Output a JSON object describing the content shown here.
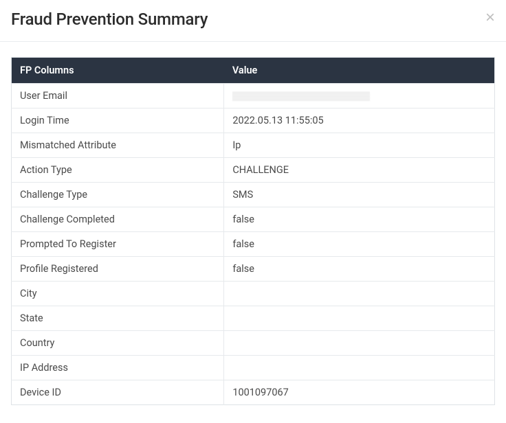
{
  "header": {
    "title": "Fraud Prevention Summary",
    "close_label": "×"
  },
  "table": {
    "columns": {
      "key": "FP Columns",
      "value": "Value"
    },
    "rows": [
      {
        "label": "User Email",
        "value": "",
        "redacted": true
      },
      {
        "label": "Login Time",
        "value": "2022.05.13 11:55:05"
      },
      {
        "label": "Mismatched Attribute",
        "value": "Ip"
      },
      {
        "label": "Action Type",
        "value": "CHALLENGE"
      },
      {
        "label": "Challenge Type",
        "value": "SMS"
      },
      {
        "label": "Challenge Completed",
        "value": "false"
      },
      {
        "label": "Prompted To Register",
        "value": "false"
      },
      {
        "label": "Profile Registered",
        "value": "false"
      },
      {
        "label": "City",
        "value": ""
      },
      {
        "label": "State",
        "value": ""
      },
      {
        "label": "Country",
        "value": ""
      },
      {
        "label": "IP Address",
        "value": ""
      },
      {
        "label": "Device ID",
        "value": "1001097067"
      }
    ]
  }
}
